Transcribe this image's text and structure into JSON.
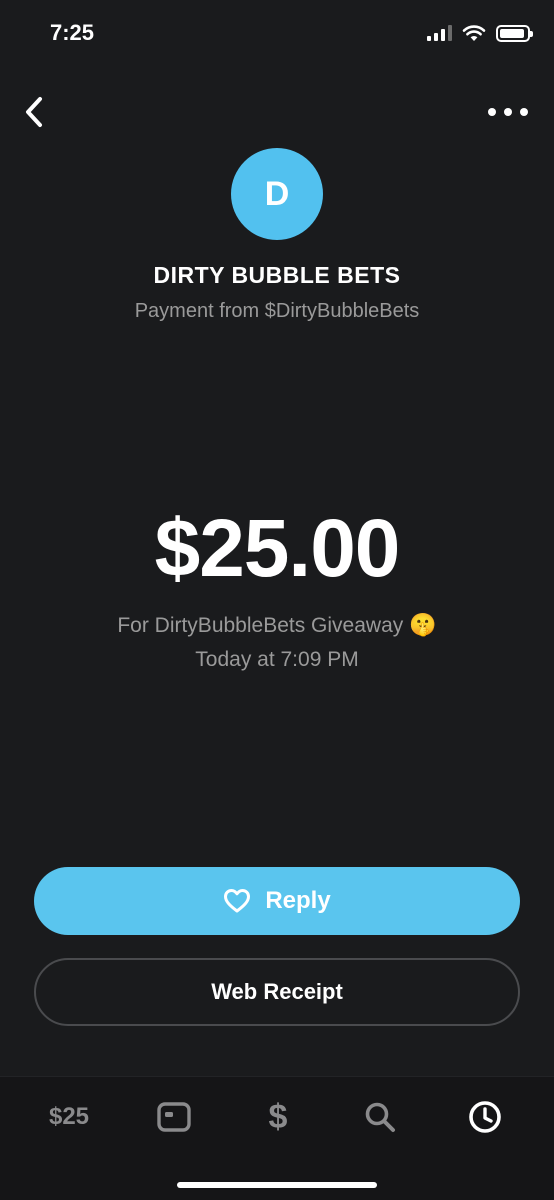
{
  "status_bar": {
    "time": "7:25"
  },
  "nav": {
    "back_icon": "chevron-left-icon",
    "more_icon": "ellipsis-icon"
  },
  "profile": {
    "initial": "D",
    "avatar_color": "#52c1ef",
    "name": "DIRTY BUBBLE BETS",
    "subtitle": "Payment from $DirtyBubbleBets"
  },
  "payment": {
    "amount": "$25.00",
    "note": "For DirtyBubbleBets Giveaway",
    "note_emoji": "🤫",
    "timestamp": "Today at 7:09 PM"
  },
  "actions": {
    "reply_label": "Reply",
    "reply_color": "#5ac5ee",
    "web_receipt_label": "Web Receipt"
  },
  "tabbar": {
    "balance_label": "$25",
    "dollar_label": "$",
    "tabs": [
      "balance",
      "card-icon",
      "dollar-sign",
      "search-icon",
      "activity-clock-icon"
    ],
    "active": "activity-clock-icon"
  }
}
